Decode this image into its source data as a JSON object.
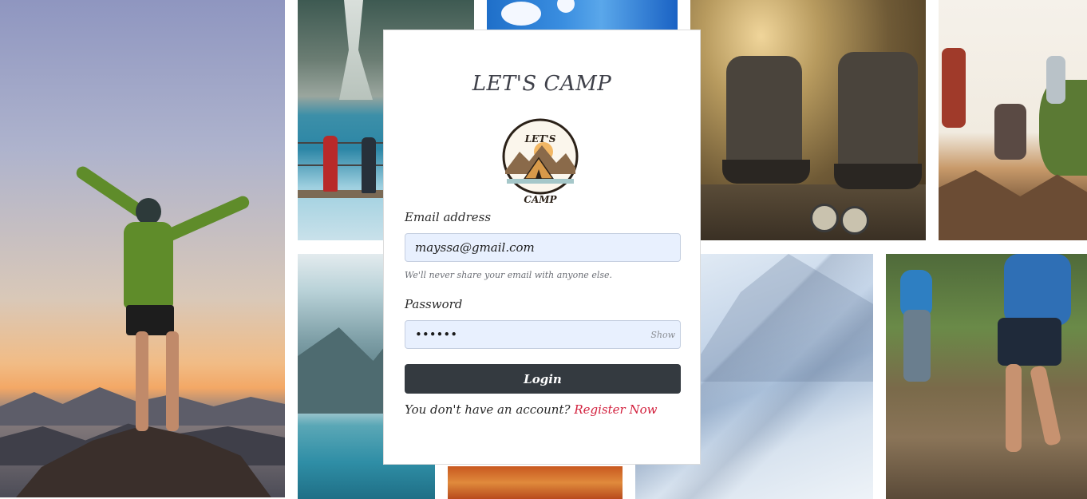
{
  "card": {
    "title": "LET'S CAMP",
    "logo": {
      "top_text": "LET'S",
      "bottom_text": "CAMP",
      "icon": "camp-tent-mountains-logo"
    }
  },
  "form": {
    "email": {
      "label": "Email address",
      "value": "mayssa@gmail.com",
      "help": "We'll never share your email with anyone else."
    },
    "password": {
      "label": "Password",
      "value": "••••••",
      "toggle_label": "Show"
    },
    "login_label": "Login",
    "register_prompt": "You don't have an account?",
    "register_link": "Register Now"
  },
  "colors": {
    "button_bg": "#343a40",
    "input_bg": "#e8f0fe",
    "link": "#d21f3c",
    "title": "#3e4049"
  }
}
